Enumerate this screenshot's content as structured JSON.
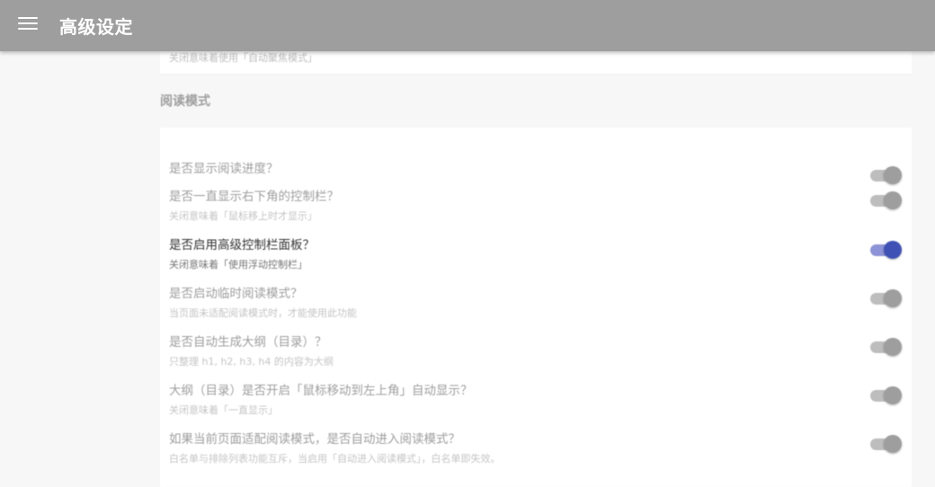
{
  "header": {
    "title": "高级设定"
  },
  "prev_card": {
    "sub": "关闭意味着使用「自动聚焦模式」"
  },
  "section": {
    "title": "阅读模式"
  },
  "settings": [
    {
      "label": "是否显示阅读进度？",
      "sub": "",
      "enabled": true
    },
    {
      "label": "是否一直显示右下角的控制栏？",
      "sub": "关闭意味着「鼠标移上时才显示」",
      "enabled": true
    },
    {
      "label": "是否启用高级控制栏面板？",
      "sub": "关闭意味着「使用浮动控制栏」",
      "enabled": true
    },
    {
      "label": "是否启动临时阅读模式？",
      "sub": "当页面未适配阅读模式时，才能使用此功能",
      "enabled": true
    },
    {
      "label": "是否自动生成大纲（目录）？",
      "sub": "只整理 h1, h2, h3, h4 的内容为大纲",
      "enabled": true
    },
    {
      "label": "大纲（目录）是否开启「鼠标移动到左上角」自动显示？",
      "sub": "关闭意味着「一直显示」",
      "enabled": true
    },
    {
      "label": "如果当前页面适配阅读模式，是否自动进入阅读模式？",
      "sub": "白名单与排除列表功能互斥，当启用「自动进入阅读模式」，白名单即失效。",
      "enabled": true
    }
  ],
  "colors": {
    "appbar": "#9e9e9e",
    "accent": "#3f51b5",
    "accent_track": "#8c93d6",
    "inactive_thumb": "#9e9e9e"
  }
}
